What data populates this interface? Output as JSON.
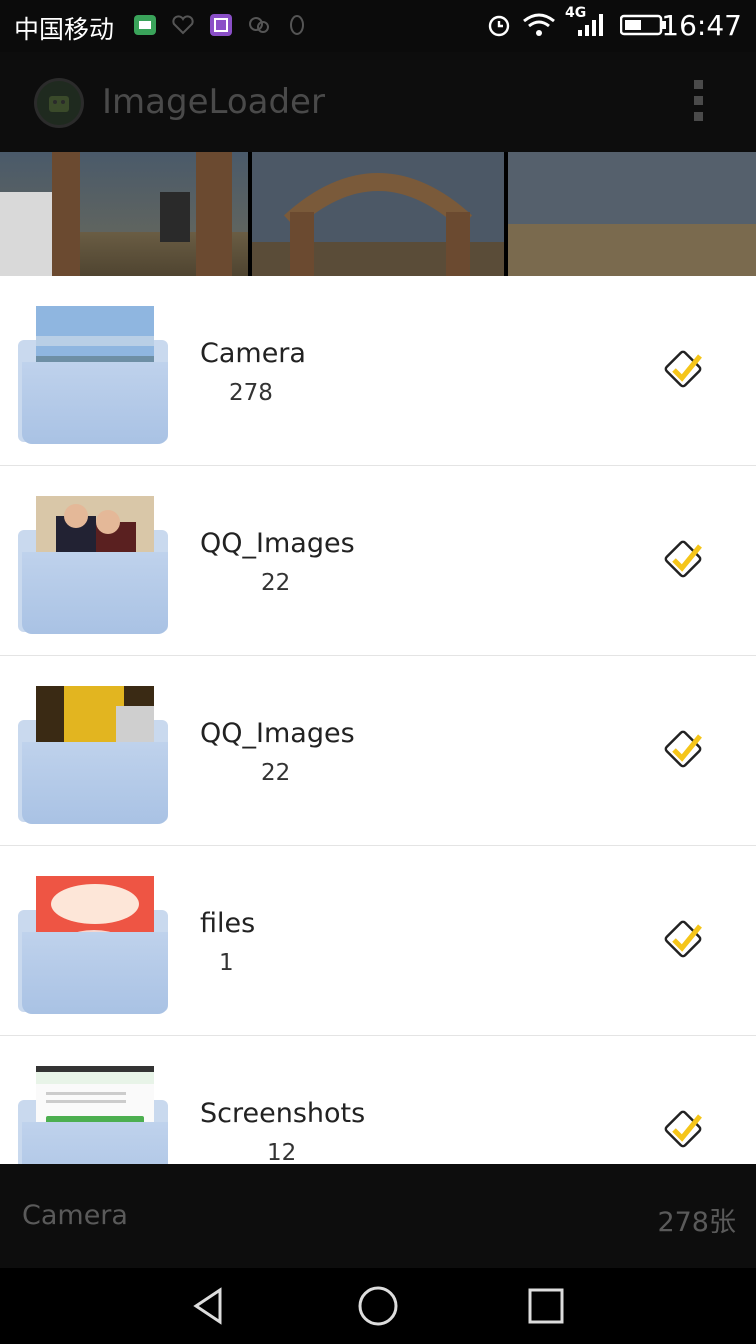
{
  "status_bar": {
    "carrier": "中国移动",
    "network": "4G",
    "time": "16:47"
  },
  "action_bar": {
    "title": "ImageLoader",
    "app_icon": "android-icon",
    "menu_icon": "overflow-menu-icon"
  },
  "folders": [
    {
      "name": "Camera",
      "count": "278"
    },
    {
      "name": "QQ_Images",
      "count": "22"
    },
    {
      "name": "QQ_Images",
      "count": "22"
    },
    {
      "name": "files",
      "count": "1"
    },
    {
      "name": "Screenshots",
      "count": "12"
    }
  ],
  "bottom_bar": {
    "current_folder": "Camera",
    "image_count": "278张"
  },
  "nav": {
    "back": "back-icon",
    "home": "home-icon",
    "recents": "recents-icon"
  },
  "colors": {
    "check_accent": "#f5c518",
    "folder_blue": "#bfd2ec"
  }
}
